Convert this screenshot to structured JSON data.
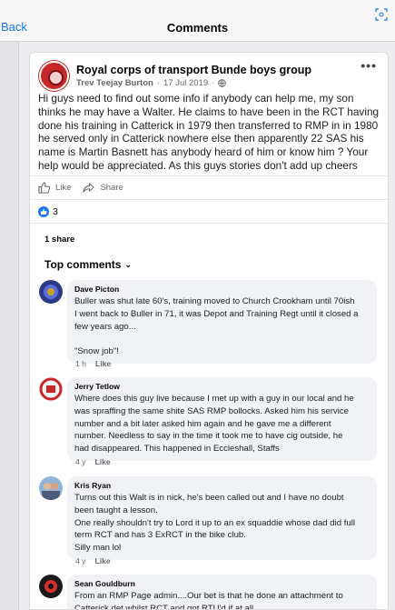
{
  "nav": {
    "back_label": "Back",
    "title": "Comments"
  },
  "post": {
    "group_name": "Royal corps of transport  Bunde boys group",
    "author": "Trev Teejay Burton",
    "sep": "·",
    "date": "17 Jul 2019",
    "text_lines": [
      "Hi guys need to find out some info if anybody can help me, my son",
      "thinks he may have a Walter. He claims to have been in the RCT having",
      "done his training in Catterick in 1979 then transferred to RMP in in 1980",
      "he served only in Catterick nowhere else then apparently 22 SAS his",
      "name is Martin Basnett has anybody heard of him or know him ? Your",
      "help would be appreciated. As this guys stories don't add up cheers"
    ],
    "like_label": "Like",
    "share_label": "Share",
    "reaction_count": "3",
    "shares_text": "1 share",
    "top_comments_label": "Top comments",
    "colors": {
      "accent": "#1877f2",
      "group_avatar": "#c62828"
    }
  },
  "comments": [
    {
      "name": "Dave Picton",
      "lines": [
        "Buller was shut late 60's, training moved to Church Crookham until 70ish",
        "I went back to Buller in 71, it was Depot and Training Regt until it closed a",
        "few years ago...",
        "",
        "\"Snow job\"!"
      ],
      "time": "1 h",
      "like_label": "Like"
    },
    {
      "name": "Jerry Tetlow",
      "lines": [
        "Where does this guy live because I met up with a guy in our local and he",
        "was spraffing the same shite SAS RMP bollocks. Asked him his service",
        "number and a bit later asked him again and he gave me a different",
        "number. Needless to say in the time it took me to have cig outside, he",
        "had disappeared. This happened in Eccleshall, Staffs"
      ],
      "time": "4 y",
      "like_label": "Like"
    },
    {
      "name": "Kris Ryan",
      "lines": [
        "Turns out this Walt is in nick, he's been called out and I have no doubt",
        "been taught a lesson.",
        "One really shouldn't try to Lord it up to an ex squaddie whose dad did full",
        "term RCT and has 3 ExRCT in the bike club.",
        "Silly man lol"
      ],
      "time": "4 y",
      "like_label": "Like"
    },
    {
      "name": "Sean Gouldburn",
      "lines": [
        "From an RMP Page admin....Our bet is that he done an attachment to",
        "Catterick det whilst RCT and got RTU'd if at all."
      ],
      "time": "",
      "like_label": ""
    }
  ]
}
